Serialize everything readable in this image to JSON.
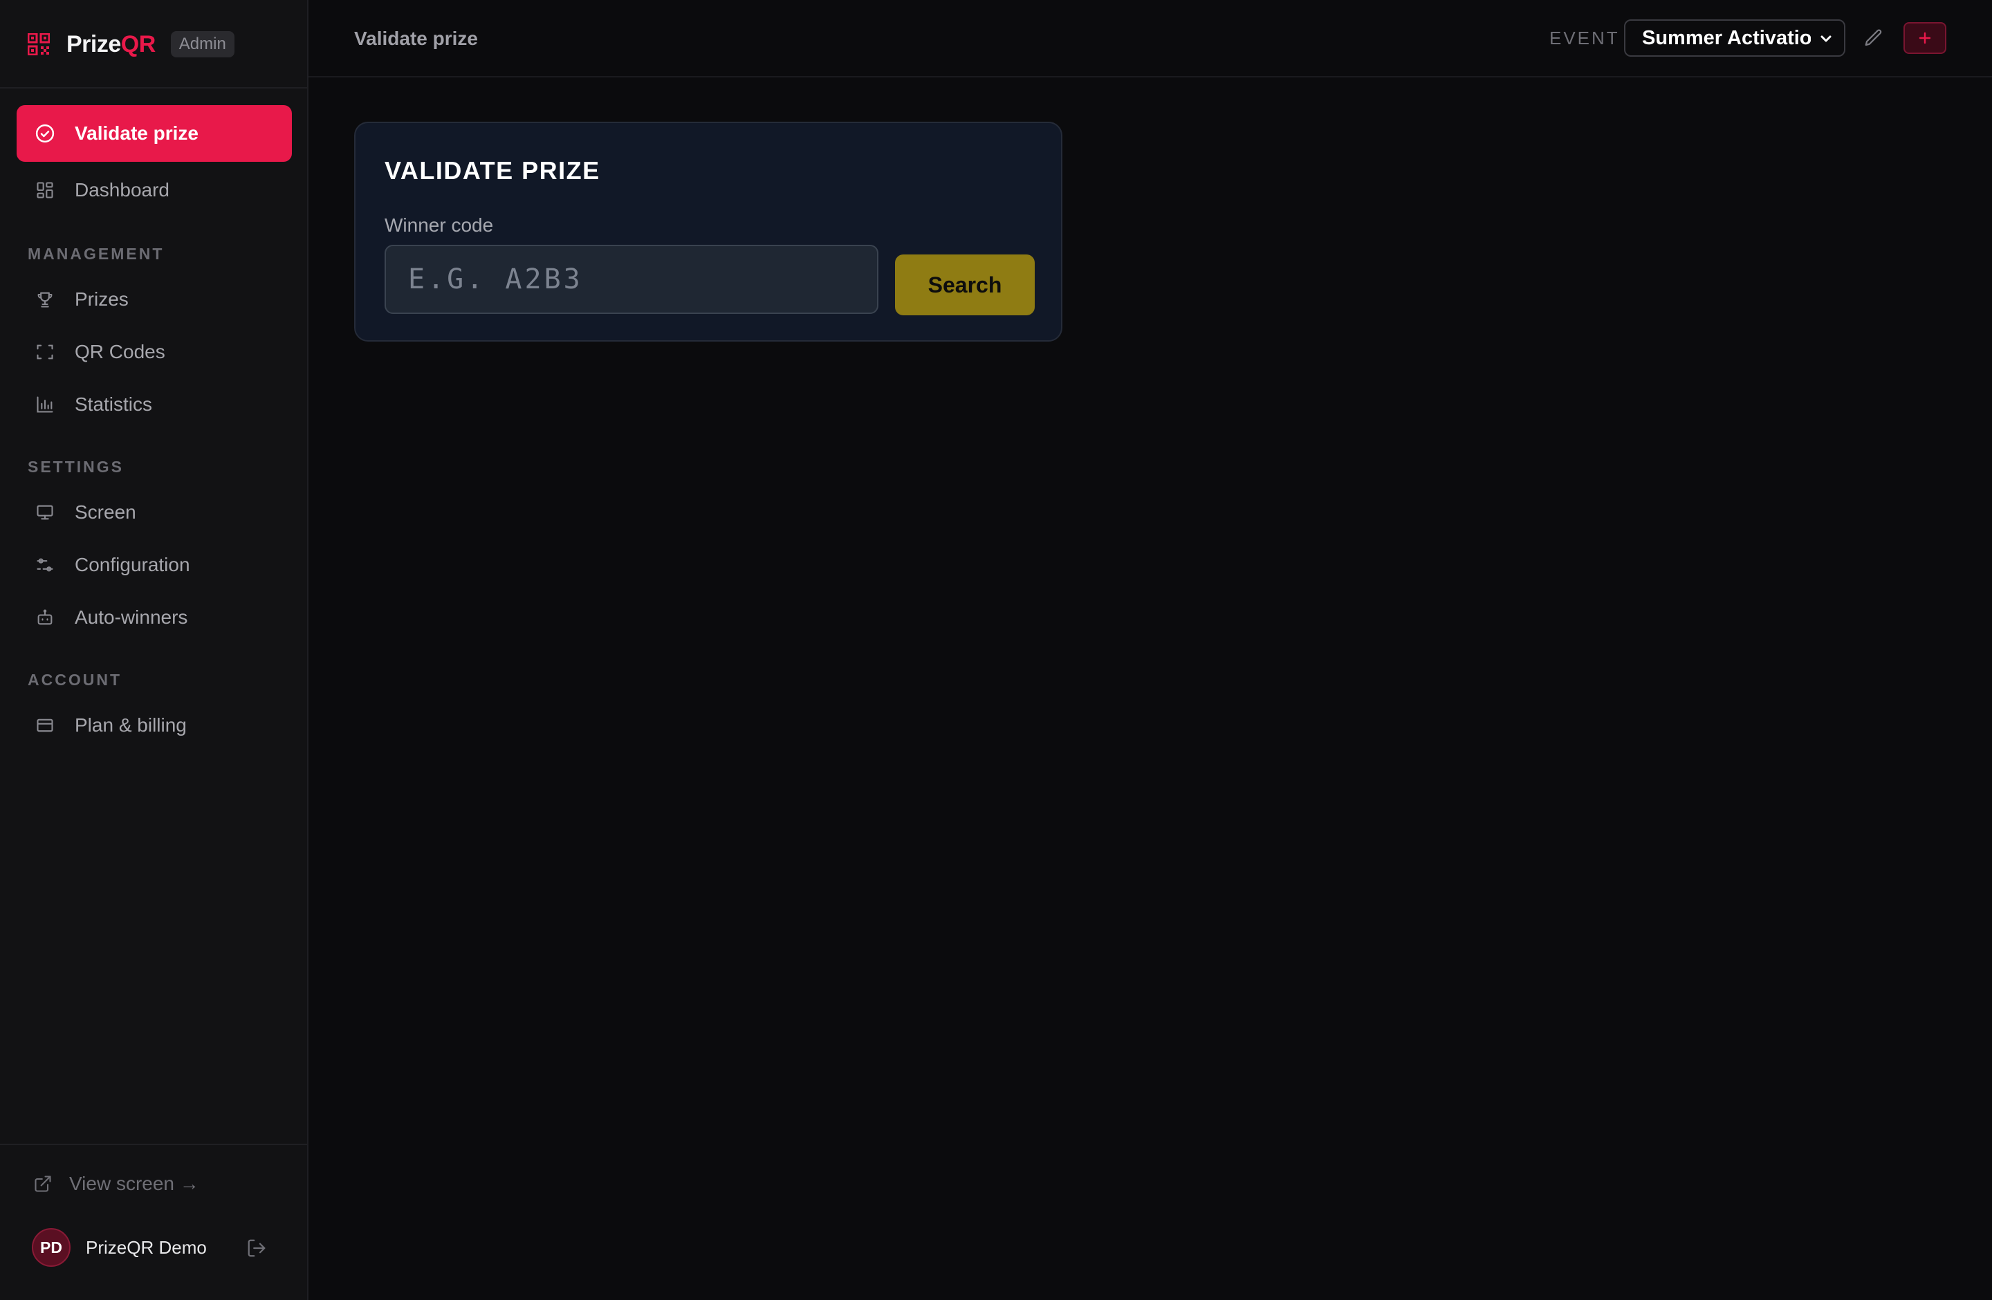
{
  "brand": {
    "name_part1": "Prize",
    "name_part2": "QR",
    "badge": "Admin",
    "accent_color": "#e8194a"
  },
  "sidebar": {
    "items": [
      {
        "label": "Validate prize",
        "icon": "check-circle-icon",
        "active": true
      },
      {
        "label": "Dashboard",
        "icon": "dashboard-icon"
      }
    ],
    "sections": [
      {
        "title": "MANAGEMENT",
        "items": [
          {
            "label": "Prizes",
            "icon": "trophy-icon"
          },
          {
            "label": "QR Codes",
            "icon": "scan-icon"
          },
          {
            "label": "Statistics",
            "icon": "bar-chart-icon"
          }
        ]
      },
      {
        "title": "SETTINGS",
        "items": [
          {
            "label": "Screen",
            "icon": "monitor-icon"
          },
          {
            "label": "Configuration",
            "icon": "sliders-icon"
          },
          {
            "label": "Auto-winners",
            "icon": "bot-icon"
          }
        ]
      },
      {
        "title": "ACCOUNT",
        "items": [
          {
            "label": "Plan & billing",
            "icon": "credit-card-icon"
          }
        ]
      }
    ],
    "footer": {
      "view_screen": "View screen →",
      "user_initials": "PD",
      "user_name": "PrizeQR Demo"
    }
  },
  "header": {
    "title": "Validate prize",
    "event_label": "EVENT",
    "event_selected": "Summer Activation"
  },
  "card": {
    "title": "VALIDATE PRIZE",
    "field_label": "Winner code",
    "input_placeholder": "E.G. A2B3",
    "input_value": "",
    "search_label": "Search",
    "search_color": "#8f7c13"
  }
}
